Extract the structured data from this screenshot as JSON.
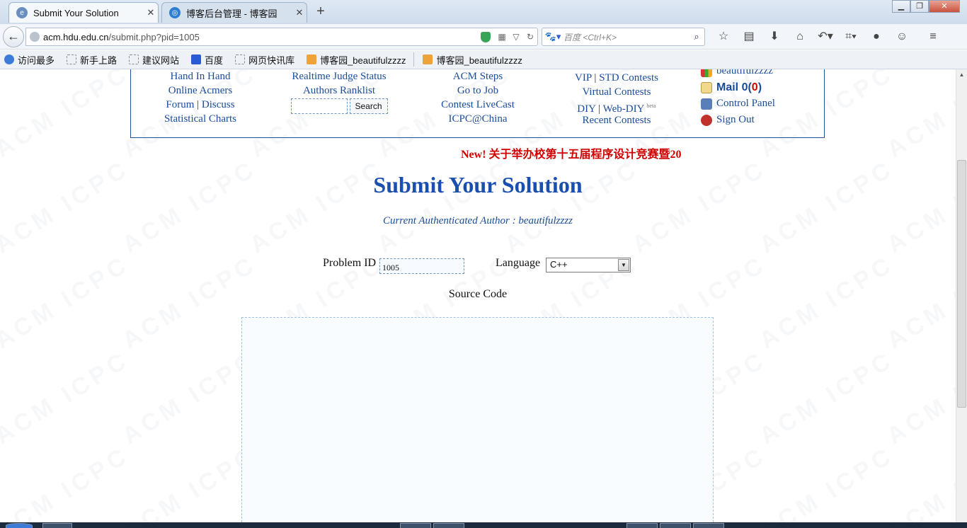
{
  "browser": {
    "tabs": [
      {
        "label": "Submit Your Solution",
        "active": true
      },
      {
        "label": "博客后台管理 - 博客园",
        "active": false
      }
    ],
    "url_host": "acm.hdu.edu.cn",
    "url_path": "/submit.php?pid=1005",
    "search_placeholder": "百度 <Ctrl+K>",
    "bookmarks": [
      "访问最多",
      "新手上路",
      "建议网站",
      "百度",
      "网页快讯库",
      "博客园_beautifulzzzz",
      "博客园_beautifulzzzz"
    ]
  },
  "menu": {
    "col1": [
      "Hand In Hand",
      "Online Acmers",
      "Forum",
      "Discuss",
      "Statistical Charts"
    ],
    "col2": [
      "Realtime Judge Status",
      "Authors Ranklist"
    ],
    "search_button": "Search",
    "col3": [
      "ACM Steps",
      "Go to Job",
      "Contest LiveCast",
      "ICPC@China"
    ],
    "col4": [
      "VIP",
      "STD Contests",
      "Virtual Contests",
      "DIY",
      "Web-DIY",
      "Recent Contests"
    ],
    "beta": "beta",
    "separator": "|",
    "user": {
      "name": "beautifulzzzz",
      "mail_prefix": "Mail 0(",
      "mail_count": "0",
      "mail_suffix": ")",
      "control_panel": "Control Panel",
      "sign_out": "Sign Out"
    }
  },
  "news": "New! 关于举办校第十五届程序设计竞赛暨20",
  "title": "Submit Your Solution",
  "author_line": "Current Authenticated Author : beautifulzzzz",
  "form": {
    "problem_id_label": "Problem ID",
    "problem_id_value": "1005",
    "language_label": "Language",
    "language_value": "C++",
    "source_code_label": "Source Code",
    "source_code_value": ""
  },
  "watermark": "ACM ICPC"
}
